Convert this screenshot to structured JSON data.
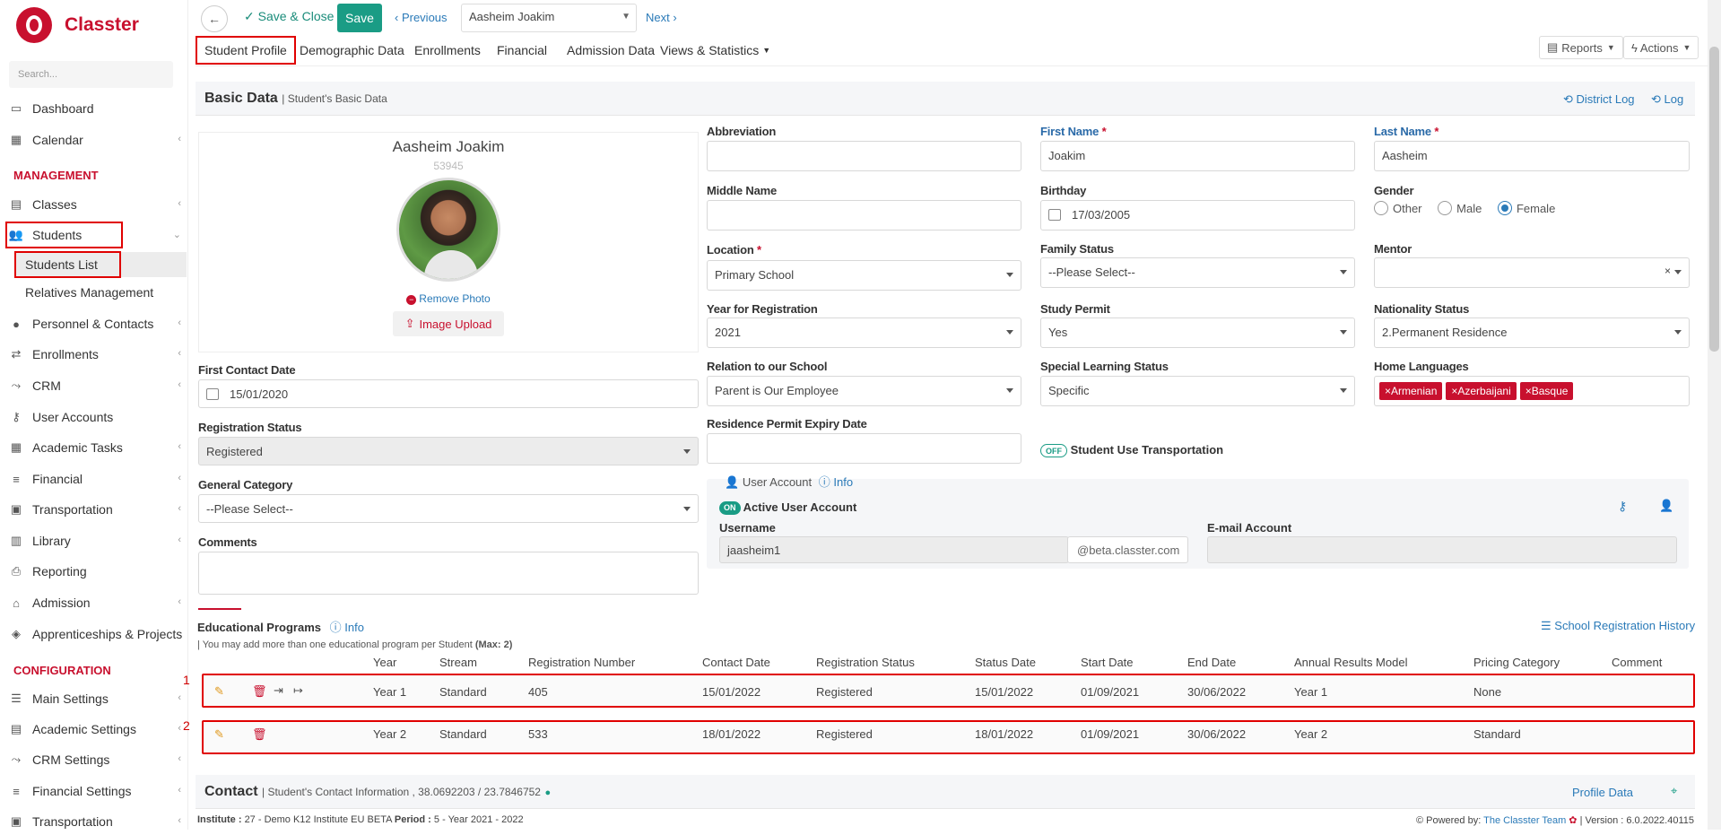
{
  "app": {
    "name": "Classter",
    "search_placeholder": "Search..."
  },
  "sidebar": {
    "items": [
      {
        "label": "Dashboard",
        "icon": "monitor-icon"
      },
      {
        "label": "Calendar",
        "icon": "calendar-icon"
      },
      {
        "section": "MANAGEMENT"
      },
      {
        "label": "Classes",
        "icon": "classes-icon"
      },
      {
        "label": "Students",
        "icon": "students-icon"
      },
      {
        "label": "Students List"
      },
      {
        "label": "Relatives Management"
      },
      {
        "label": "Personnel & Contacts",
        "icon": "person-icon"
      },
      {
        "label": "Enrollments",
        "icon": "arrows-icon"
      },
      {
        "label": "CRM",
        "icon": "crm-icon"
      },
      {
        "label": "User Accounts",
        "icon": "key-icon"
      },
      {
        "label": "Academic Tasks",
        "icon": "grid-icon"
      },
      {
        "label": "Financial",
        "icon": "coins-icon"
      },
      {
        "label": "Transportation",
        "icon": "bus-icon"
      },
      {
        "label": "Library",
        "icon": "books-icon"
      },
      {
        "label": "Reporting",
        "icon": "printer-icon"
      },
      {
        "label": "Admission",
        "icon": "bank-icon"
      },
      {
        "label": "Apprenticeships & Projects",
        "icon": "cube-icon"
      },
      {
        "section": "CONFIGURATION"
      },
      {
        "label": "Main Settings",
        "icon": "sliders-icon"
      },
      {
        "label": "Academic Settings",
        "icon": "classes-icon"
      },
      {
        "label": "CRM Settings",
        "icon": "crm-icon"
      },
      {
        "label": "Financial Settings",
        "icon": "coins-icon"
      },
      {
        "label": "Transportation",
        "icon": "bus-icon"
      }
    ]
  },
  "toolbar": {
    "save_close": "Save & Close",
    "save": "Save",
    "previous": "Previous",
    "student": "Aasheim Joakim",
    "next": "Next"
  },
  "tabs": [
    "Student Profile",
    "Demographic Data",
    "Enrollments",
    "Financial",
    "Admission Data",
    "Views & Statistics"
  ],
  "right_buttons": {
    "reports": "Reports",
    "actions": "Actions"
  },
  "basic": {
    "title": "Basic Data",
    "subtitle": "| Student's Basic Data",
    "district_log": "District Log",
    "log": "Log",
    "name": "Aasheim Joakim",
    "id": "53945",
    "remove_photo": "Remove Photo",
    "image_upload": "Image Upload"
  },
  "fields": {
    "abbreviation": {
      "label": "Abbreviation",
      "value": ""
    },
    "first_name": {
      "label": "First Name",
      "value": "Joakim"
    },
    "last_name": {
      "label": "Last Name",
      "value": "Aasheim"
    },
    "middle_name": {
      "label": "Middle Name",
      "value": ""
    },
    "birthday": {
      "label": "Birthday",
      "value": "17/03/2005"
    },
    "gender": {
      "label": "Gender",
      "options": [
        "Other",
        "Male",
        "Female"
      ],
      "selected": "Female"
    },
    "location": {
      "label": "Location",
      "value": "Primary School"
    },
    "family_status": {
      "label": "Family Status",
      "value": "--Please Select--"
    },
    "mentor": {
      "label": "Mentor",
      "value": ""
    },
    "year_registration": {
      "label": "Year for Registration",
      "value": "2021"
    },
    "study_permit": {
      "label": "Study Permit",
      "value": "Yes"
    },
    "nationality_status": {
      "label": "Nationality Status",
      "value": "2.Permanent Residence"
    },
    "first_contact": {
      "label": "First Contact Date",
      "value": "15/01/2020"
    },
    "relation": {
      "label": "Relation to our School",
      "value": "Parent is Our Employee"
    },
    "special_learning": {
      "label": "Special Learning Status",
      "value": "Specific"
    },
    "home_languages": {
      "label": "Home Languages",
      "tags": [
        "×Armenian",
        "×Azerbaijani",
        "×Basque"
      ]
    },
    "registration_status": {
      "label": "Registration Status",
      "value": "Registered"
    },
    "residence_permit": {
      "label": "Residence Permit Expiry Date",
      "value": ""
    },
    "transportation": {
      "toggle": "OFF",
      "label": "Student Use Transportation"
    },
    "general_category": {
      "label": "General Category",
      "value": "--Please Select--"
    },
    "comments": {
      "label": "Comments",
      "value": ""
    }
  },
  "user_account": {
    "title": "User Account",
    "info": "Info",
    "toggle": "ON",
    "active_label": "Active User Account",
    "username_label": "Username",
    "username": "jaasheim1",
    "domain": "@beta.classter.com",
    "email_label": "E-mail Account",
    "email": ""
  },
  "edu": {
    "title": "Educational Programs",
    "info": "Info",
    "note": "| You may add more than one educational program per Student",
    "note_max": "(Max: 2)",
    "history": "School Registration History",
    "columns": [
      "Year",
      "Stream",
      "Registration Number",
      "Contact Date",
      "Registration Status",
      "Status Date",
      "Start Date",
      "End Date",
      "Annual Results Model",
      "Pricing Category",
      "Comment"
    ],
    "rows": [
      {
        "num": "1",
        "cells": [
          "Year 1",
          "Standard",
          "405",
          "15/01/2022",
          "Registered",
          "15/01/2022",
          "01/09/2021",
          "30/06/2022",
          "Year 1",
          "None",
          ""
        ]
      },
      {
        "num": "2",
        "cells": [
          "Year 2",
          "Standard",
          "533",
          "18/01/2022",
          "Registered",
          "18/01/2022",
          "01/09/2021",
          "30/06/2022",
          "Year 2",
          "Standard",
          ""
        ]
      }
    ]
  },
  "contact": {
    "title": "Contact",
    "subtitle": "| Student's Contact Information , 38.0692203 / 23.7846752",
    "profile_data": "Profile Data"
  },
  "footer": {
    "institute_label": "Institute :",
    "institute": "27 - Demo K12 Institute EU BETA",
    "period_label": "Period :",
    "period": "5 - Year 2021 - 2022",
    "powered": "Powered by:",
    "team": "The Classter Team",
    "version": "| Version : 6.0.2022.40115"
  },
  "colors": {
    "brand": "#c8102e",
    "accent": "#1a9c85",
    "link": "#2a7ab8",
    "highlight": "#e00000"
  }
}
